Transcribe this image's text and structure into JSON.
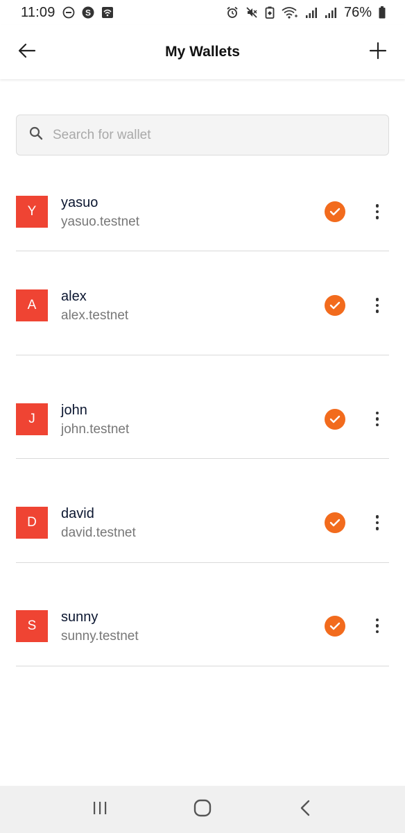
{
  "status_bar": {
    "time": "11:09",
    "battery": "76%",
    "icons": [
      "minus-circle-icon",
      "s-app-icon",
      "wifi-badge-icon",
      "alarm-icon",
      "mute-icon",
      "battery-saver-icon",
      "wifi-icon",
      "signal-icon",
      "signal-icon",
      "battery-icon"
    ]
  },
  "header": {
    "title": "My Wallets",
    "back_icon": "arrow-left-icon",
    "add_icon": "plus-icon"
  },
  "search": {
    "placeholder": "Search for wallet",
    "value": ""
  },
  "wallets": [
    {
      "initial": "Y",
      "name": "yasuo",
      "account": "yasuo.testnet",
      "selected": true
    },
    {
      "initial": "A",
      "name": "alex",
      "account": "alex.testnet",
      "selected": true
    },
    {
      "initial": "J",
      "name": "john",
      "account": "john.testnet",
      "selected": true
    },
    {
      "initial": "D",
      "name": "david",
      "account": "david.testnet",
      "selected": true
    },
    {
      "initial": "S",
      "name": "sunny",
      "account": "sunny.testnet",
      "selected": true
    }
  ],
  "colors": {
    "avatar_bg": "#ef4433",
    "check_bg": "#f26b1d",
    "name_text": "#0b1630",
    "account_text": "#777777"
  },
  "nav_bar": {
    "icons": [
      "recent-apps-icon",
      "home-icon",
      "back-icon"
    ]
  }
}
